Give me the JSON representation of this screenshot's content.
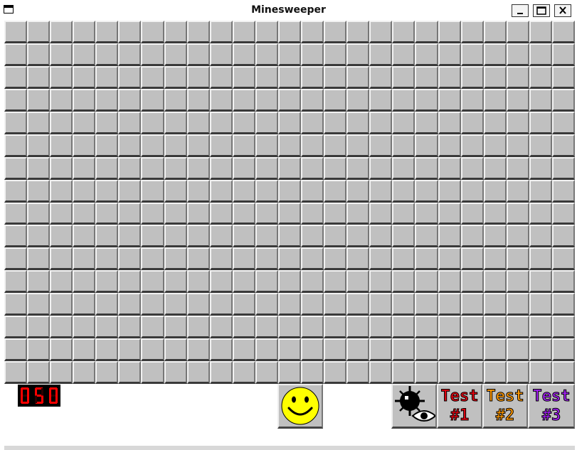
{
  "window": {
    "title": "Minesweeper",
    "buttons": [
      "minimize",
      "maximize",
      "close"
    ]
  },
  "board": {
    "columns": 25,
    "rows": 16,
    "cell_state": "unrevealed",
    "cell_color": "#c0c0c0"
  },
  "mine_counter": {
    "value": "050",
    "digit_color": "#ff0000"
  },
  "toolbar": {
    "smiley": {
      "icon": "smiley-face-icon",
      "color": "#ffff00"
    },
    "peek": {
      "icon": "mine-eye-icon"
    },
    "tests": [
      {
        "line1": "Test",
        "line2": "#1",
        "color": "#e00010"
      },
      {
        "line1": "Test",
        "line2": "#2",
        "color": "#ff9900"
      },
      {
        "line1": "Test",
        "line2": "#3",
        "color": "#a020f0"
      }
    ]
  }
}
